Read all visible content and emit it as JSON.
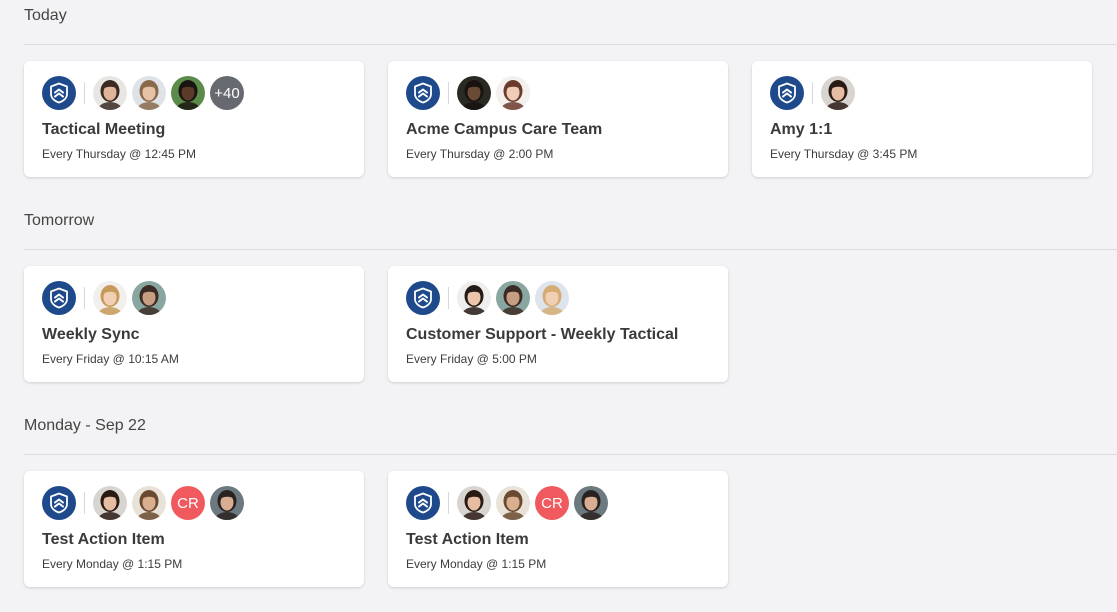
{
  "sections": [
    {
      "title": "Today",
      "meetings": [
        {
          "title": "Tactical Meeting",
          "schedule": "Every Thursday @ 12:45 PM",
          "avatars": [
            {
              "type": "photo",
              "skin": "#e0b49a",
              "hair": "#3a2a22",
              "bg": "#e8e6e2"
            },
            {
              "type": "photo",
              "skin": "#e8c2a6",
              "hair": "#8a6a4c",
              "bg": "#dfe3e8"
            },
            {
              "type": "photo",
              "skin": "#5a3a28",
              "hair": "#1a1410",
              "bg": "#5c8a4a"
            }
          ],
          "more": "+40"
        },
        {
          "title": "Acme Campus Care Team",
          "schedule": "Every Thursday @ 2:00 PM",
          "avatars": [
            {
              "type": "photo",
              "skin": "#6a4a34",
              "hair": "#181210",
              "bg": "#2a2a22"
            },
            {
              "type": "photo",
              "skin": "#f0cdb8",
              "hair": "#6a3a2c",
              "bg": "#f4f0ee"
            }
          ]
        },
        {
          "title": "Amy 1:1",
          "schedule": "Every Thursday @ 3:45 PM",
          "avatars": [
            {
              "type": "photo",
              "skin": "#e6bda2",
              "hair": "#2a1a14",
              "bg": "#d8d4d0"
            }
          ]
        }
      ]
    },
    {
      "title": "Tomorrow",
      "meetings": [
        {
          "title": "Weekly Sync",
          "schedule": "Every Friday @ 10:15 AM",
          "avatars": [
            {
              "type": "photo",
              "skin": "#f0cfb4",
              "hair": "#c89a5a",
              "bg": "#f2f0ec"
            },
            {
              "type": "photo",
              "skin": "#c89e82",
              "hair": "#3a2c24",
              "bg": "#8aa6a0"
            }
          ]
        },
        {
          "title": "Customer Support - Weekly Tactical",
          "schedule": "Every Friday @ 5:00 PM",
          "avatars": [
            {
              "type": "photo",
              "skin": "#ecc6aa",
              "hair": "#241a16",
              "bg": "#eeeeee"
            },
            {
              "type": "photo",
              "skin": "#c89e82",
              "hair": "#3a2c24",
              "bg": "#8aa6a0"
            },
            {
              "type": "photo",
              "skin": "#f0cfb4",
              "hair": "#d4ac74",
              "bg": "#dde4ec"
            }
          ]
        }
      ]
    },
    {
      "title": "Monday - Sep 22",
      "meetings": [
        {
          "title": "Test Action Item",
          "schedule": "Every Monday @ 1:15 PM",
          "avatars": [
            {
              "type": "photo",
              "skin": "#e6bda2",
              "hair": "#2a1a14",
              "bg": "#d8d4d0"
            },
            {
              "type": "photo",
              "skin": "#d8b090",
              "hair": "#6a4a30",
              "bg": "#e8e2d8"
            },
            {
              "type": "initials",
              "text": "CR",
              "color": "#f05a5e"
            },
            {
              "type": "photo",
              "skin": "#d8ae92",
              "hair": "#2a2220",
              "bg": "#6c7a80"
            }
          ]
        },
        {
          "title": "Test Action Item",
          "schedule": "Every Monday @ 1:15 PM",
          "avatars": [
            {
              "type": "photo",
              "skin": "#e6bda2",
              "hair": "#2a1a14",
              "bg": "#d8d4d0"
            },
            {
              "type": "photo",
              "skin": "#d8b090",
              "hair": "#6a4a30",
              "bg": "#e8e2d8"
            },
            {
              "type": "initials",
              "text": "CR",
              "color": "#f05a5e"
            },
            {
              "type": "photo",
              "skin": "#d8ae92",
              "hair": "#2a2220",
              "bg": "#6c7a80"
            }
          ]
        }
      ]
    }
  ],
  "icons": {
    "team_logo": "shield-chevron-icon",
    "brand_color": "#1e4a8c"
  }
}
